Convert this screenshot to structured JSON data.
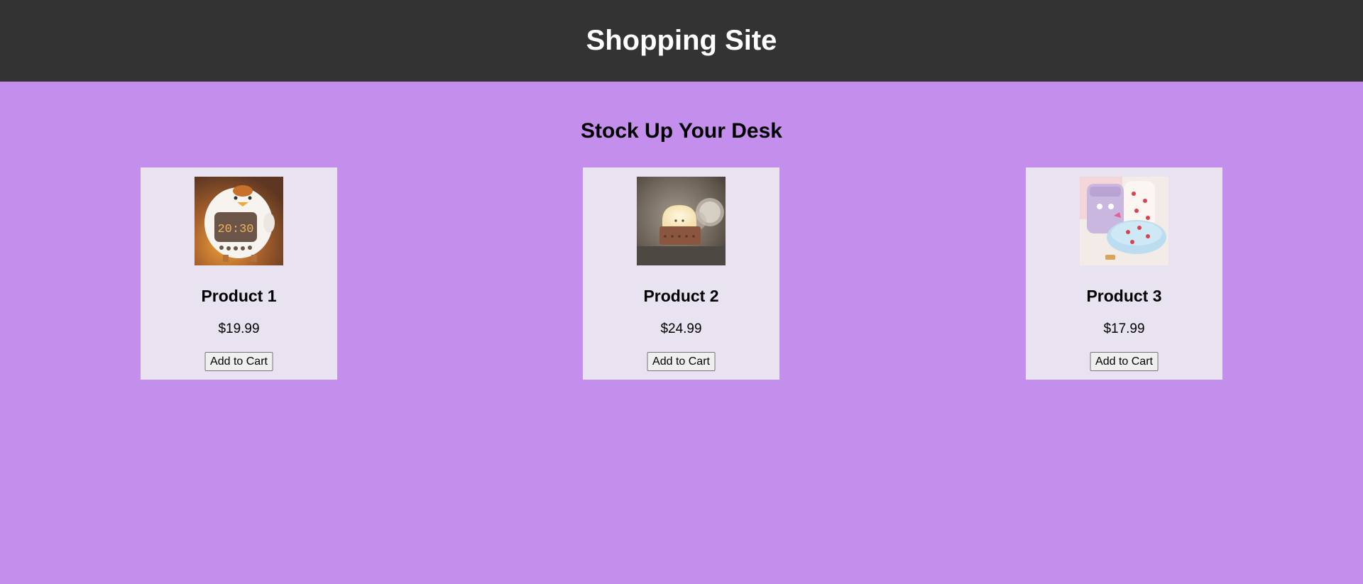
{
  "header": {
    "title": "Shopping Site",
    "background": "#333333"
  },
  "main": {
    "heading": "Stock Up Your Desk",
    "background": "#c48eec",
    "card_background": "#e9e2f0",
    "products": [
      {
        "name": "Product 1",
        "price": "$19.99",
        "button_label": "Add to Cart",
        "image": "chick-alarm-clock-image"
      },
      {
        "name": "Product 2",
        "price": "$24.99",
        "button_label": "Add to Cart",
        "image": "toast-night-light-image"
      },
      {
        "name": "Product 3",
        "price": "$17.99",
        "button_label": "Add to Cart",
        "image": "pencil-cases-image"
      }
    ]
  }
}
